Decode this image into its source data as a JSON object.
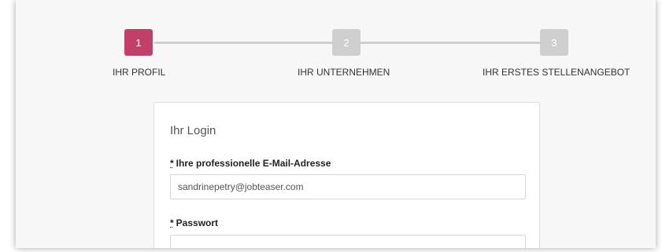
{
  "stepper": {
    "steps": [
      {
        "number": "1",
        "label": "IHR PROFIL",
        "state": "active"
      },
      {
        "number": "2",
        "label": "IHR UNTERNEHMEN",
        "state": "inactive"
      },
      {
        "number": "3",
        "label": "IHR ERSTES STELLENANGEBOT",
        "state": "inactive"
      }
    ]
  },
  "login_form": {
    "title": "Ihr Login",
    "required_marker": "*",
    "email": {
      "label": "Ihre professionelle E-Mail-Adresse",
      "value": "sandrinepetry@jobteaser.com"
    },
    "password": {
      "label": "Passwort",
      "value": ""
    }
  },
  "colors": {
    "active_step": "#c23f6a",
    "inactive_step": "#cfcfcf",
    "background": "#f7f7f7"
  }
}
